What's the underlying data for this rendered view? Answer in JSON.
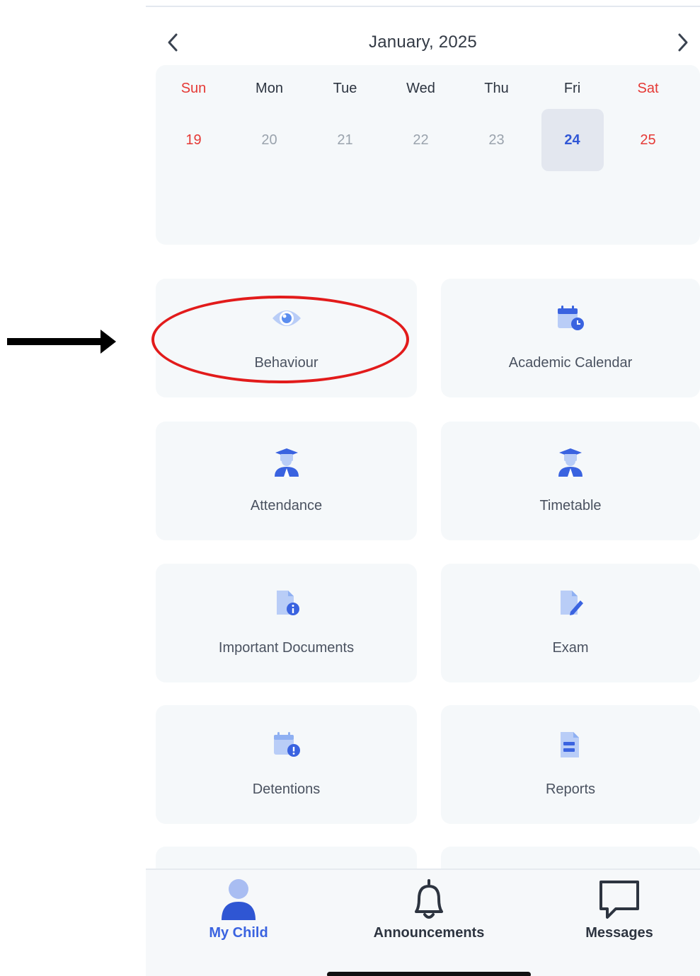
{
  "calendar": {
    "month_label": "January, 2025",
    "prev_icon": "chevron-left-icon",
    "next_icon": "chevron-right-icon",
    "weekdays": [
      "Sun",
      "Mon",
      "Tue",
      "Wed",
      "Thu",
      "Fri",
      "Sat"
    ],
    "dates": [
      "19",
      "20",
      "21",
      "22",
      "23",
      "24",
      "25"
    ],
    "selected_date": "24"
  },
  "tiles": [
    {
      "label": "Behaviour",
      "icon": "eye-icon"
    },
    {
      "label": "Academic Calendar",
      "icon": "calendar-clock-icon"
    },
    {
      "label": "Attendance",
      "icon": "student-icon"
    },
    {
      "label": "Timetable",
      "icon": "student-icon"
    },
    {
      "label": "Important Documents",
      "icon": "document-info-icon"
    },
    {
      "label": "Exam",
      "icon": "document-edit-icon"
    },
    {
      "label": "Detentions",
      "icon": "calendar-alert-icon"
    },
    {
      "label": "Reports",
      "icon": "report-icon"
    }
  ],
  "bottom_nav": [
    {
      "label": "My Child",
      "icon": "person-icon",
      "active": true
    },
    {
      "label": "Announcements",
      "icon": "bell-icon",
      "active": false
    },
    {
      "label": "Messages",
      "icon": "chat-bubble-icon",
      "active": false
    }
  ],
  "colors": {
    "accent": "#3a63e0",
    "icon_blue": "#5b8def",
    "weekend_red": "#e53935",
    "annotation_red": "#e21b1b"
  }
}
